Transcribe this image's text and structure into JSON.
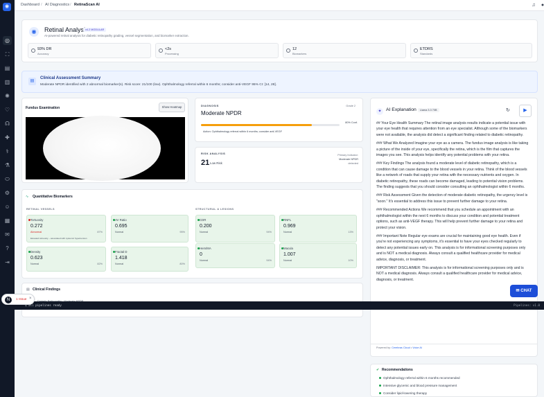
{
  "breadcrumb": [
    "Dashboard",
    "AI Diagnostics",
    "RetinaScan AI"
  ],
  "header": {
    "title": "Retinal Analysis",
    "badge": "v4.2 MODULAR",
    "subtitle": "AI-powered retinal analysis for diabetic retinopathy grading, vessel segmentation, and biomarker extraction."
  },
  "stats": [
    {
      "value": "93% DR",
      "label": "Accuracy"
    },
    {
      "value": "<2s",
      "label": "Processing"
    },
    {
      "value": "12",
      "label": "Biomarkers"
    },
    {
      "value": "ETDRS",
      "label": "Standards"
    }
  ],
  "summary": {
    "title": "Clinical Assessment Summary",
    "text": "Moderate NPDR identified with 2 abnormal biomarker(s). Risk score: 21/100 (low). Ophthalmology referral within 6 months; consider anti-VEGF 95% CI: [14, 28]."
  },
  "fundus": {
    "title": "Fundus Examination",
    "button": "Show Heatmap"
  },
  "diagnosis": {
    "label": "DIAGNOSIS",
    "value": "Moderate NPDR",
    "grade": "Grade 2",
    "conf": "80% Conf.",
    "action": "Action: Ophthalmology referral within 6 months; consider anti-VEGF"
  },
  "risk": {
    "label": "RISK ANALYSIS",
    "score": "21",
    "level": "Low Risk",
    "primary_label": "Primary Indicator:",
    "primary_value": "Moderate NPDR",
    "primary_state": "detected"
  },
  "biomarkers": {
    "title": "Quantitative Biomarkers",
    "vessels_header": "RETINAL VESSELS",
    "structural_header": "STRUCTURAL & LESIONS",
    "vessels": [
      {
        "name": "Tortuosity",
        "value": "0.272",
        "status": "Abnormal",
        "pct": "87%",
        "note": "Elevated tortuosity – associated with systemic hypertension"
      },
      {
        "name": "AV Ratio",
        "value": "0.695",
        "status": "Normal",
        "pct": "95%"
      },
      {
        "name": "Density",
        "value": "0.623",
        "status": "Normal",
        "pct": "82%"
      },
      {
        "name": "Fractal D",
        "value": "1.418",
        "status": "Normal",
        "pct": "80%"
      }
    ],
    "structural": [
      {
        "name": "CDR",
        "value": "0.200",
        "status": "Normal",
        "pct": "94%"
      },
      {
        "name": "RNFL",
        "value": "0.969",
        "status": "Normal",
        "pct": "13%"
      },
      {
        "name": "Hem/MA",
        "value": "0",
        "status": "Normal",
        "pct": "94%"
      },
      {
        "name": "Macula",
        "value": "1.007",
        "status": "Normal",
        "pct": "10%"
      }
    ]
  },
  "clinical_findings": {
    "title": "Clinical Findings",
    "row": "Diabetic Retinopathy · Moderate NPDR"
  },
  "ai": {
    "title": "AI Explanation",
    "model": "Llama 3.3 70B",
    "paragraphs": [
      "## Your Eye Health Summary The retinal image analysis results indicate a potential issue with your eye health that requires attention from an eye specialist. Although some of the biomarkers were not available, the analysis did detect a significant finding related to diabetic retinopathy.",
      "### What We Analyzed Imagine your eye as a camera. The fundus image analysis is like taking a picture of the inside of your eye, specifically the retina, which is the film that captures the images you see. This analysis helps identify any potential problems with your retina.",
      "### Key Findings The analysis found a moderate level of diabetic retinopathy, which is a condition that can cause damage to the blood vessels in your retina. Think of the blood vessels like a network of roads that supply your retina with the necessary nutrients and oxygen. In diabetic retinopathy, these roads can become damaged, leading to potential vision problems. The finding suggests that you should consider consulting an ophthalmologist within 6 months.",
      "### Risk Assessment Given the detection of moderate diabetic retinopathy, the urgency level is \"soon.\" It's essential to address this issue to prevent further damage to your retina.",
      "### Recommended Actions We recommend that you schedule an appointment with an ophthalmologist within the next 6 months to discuss your condition and potential treatment options, such as anti-VEGF therapy. This will help prevent further damage to your retina and protect your vision.",
      "### Important Note Regular eye exams are crucial for maintaining good eye health. Even if you're not experiencing any symptoms, it's essential to have your eyes checked regularly to detect any potential issues early on. This analysis is for informational screening purposes only and is NOT a medical diagnosis. Always consult a qualified healthcare provider for medical advice, diagnosis, or treatment.",
      "IMPORTANT DISCLAIMER: This analysis is for informational screening purposes only and is NOT a medical diagnosis. Always consult a qualified healthcare provider for medical advice, diagnosis, or treatment."
    ],
    "powered_label": "Powered by:",
    "powered_by": "Cerebras Cloud",
    "powered_sep": "•",
    "powered_by2": "Voice AI"
  },
  "recommendations": {
    "title": "Recommendations",
    "items": [
      "Ophthalmology referral within 6 months recommended",
      "Intensive glycemic and blood pressure management",
      "Consider lipid-lowering therapy"
    ]
  },
  "terminal": {
    "line1": "$  all pipelines ready",
    "right": "Pipelines: v1.0"
  },
  "issue": {
    "label": "1 Issue"
  },
  "chat": {
    "label": "CHAT"
  },
  "colors": {
    "accent": "#2563eb",
    "normal_bg": "#e8f5ea",
    "sidebar": "#111827"
  }
}
